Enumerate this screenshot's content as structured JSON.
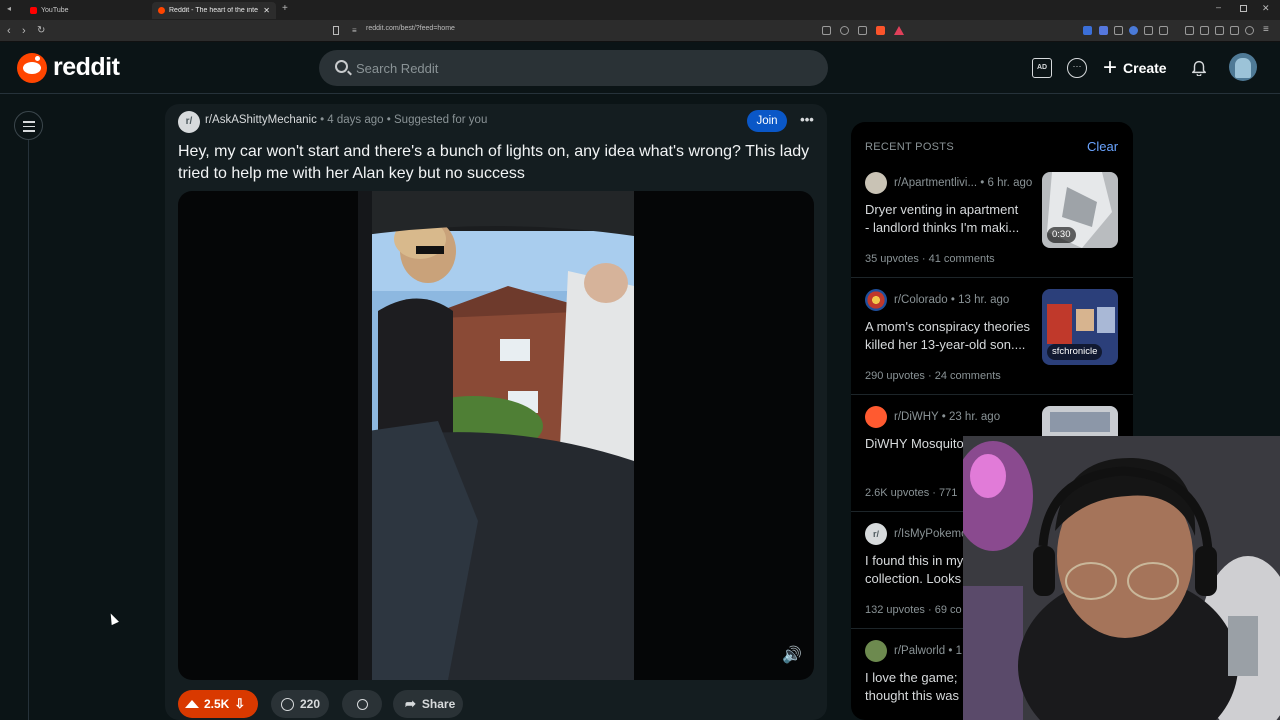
{
  "browser": {
    "tabs": [
      {
        "label": "YouTube",
        "favicon_color": "#ff0000"
      },
      {
        "label": "Reddit - The heart of the inte",
        "favicon_color": "#ff4500"
      }
    ],
    "url": "reddit.com/best/?feed=home"
  },
  "header": {
    "logo_text": "reddit",
    "search_placeholder": "Search Reddit",
    "ads_icon_text": "AD",
    "create_label": "Create"
  },
  "post": {
    "subreddit": "r/AskAShittyMechanic",
    "subreddit_icon_text": "r/",
    "time": "4 days ago",
    "suggestion": "Suggested for you",
    "join_label": "Join",
    "title": "Hey, my car won't start and there's a bunch of lights on, any idea what's wrong? This lady tried to help me with her Alan key but no success",
    "upvotes": "2.5K",
    "comments": "220",
    "share_label": "Share"
  },
  "recent": {
    "heading": "RECENT POSTS",
    "clear_label": "Clear",
    "items": [
      {
        "subreddit": "r/Apartmentlivi...",
        "time": "6 hr. ago",
        "title_line1": "Dryer venting in apartment",
        "title_line2": "- landlord thinks I'm maki...",
        "upvotes": "35 upvotes",
        "comments": "41 comments",
        "badge": "0:30"
      },
      {
        "subreddit": "r/Colorado",
        "time": "13 hr. ago",
        "title_line1": "A mom's conspiracy theories",
        "title_line2": "killed her 13-year-old son....",
        "upvotes": "290 upvotes",
        "comments": "24 comments",
        "badge": "sfchronicle"
      },
      {
        "subreddit": "r/DiWHY",
        "time": "23 hr. ago",
        "title_line1": "DiWHY Mosquito",
        "title_line2": "",
        "upvotes": "2.6K upvotes",
        "comments": "771"
      },
      {
        "subreddit": "r/IsMyPokemo",
        "time": "",
        "title_line1": "I found this in my",
        "title_line2": "collection. Looks",
        "upvotes": "132 upvotes",
        "comments": "69 co"
      },
      {
        "subreddit": "r/Palworld",
        "time": "1",
        "title_line1": "I love the game;",
        "title_line2": "thought this was",
        "upvotes": "",
        "comments": ""
      }
    ]
  }
}
